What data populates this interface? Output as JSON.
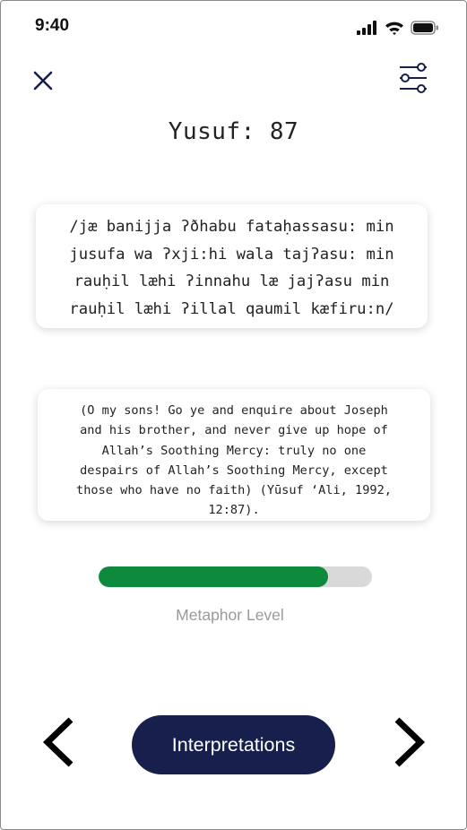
{
  "status_bar": {
    "time": "9:40",
    "icons": [
      "cellular-signal-icon",
      "wifi-icon",
      "battery-icon"
    ]
  },
  "header": {
    "close_icon": "close-icon",
    "filter_icon": "filter-sliders-icon"
  },
  "title": "Yusuf: 87",
  "transcription": "/jæ banijja ʔðhabu fataḥassasu: min\njusufa wa ʔxji:hi wala tajʔasu: min\nrauḥil læhi ʔinnahu læ jajʔasu min\nrauḥil læhi ʔillal qaumil kæfiru:n/",
  "translation": "(O my sons! Go ye and enquire about Joseph\nand his brother, and never give up hope of\nAllah’s Soothing Mercy: truly no one\ndespairs of Allah’s Soothing Mercy, except\nthose who have no faith) (Yūsuf ‘Ali, 1992,\n12:87).",
  "metaphor": {
    "label": "Metaphor Level",
    "level": 0.84
  },
  "footer": {
    "button_label": "Interpretations",
    "prev_icon": "chevron-left-icon",
    "next_icon": "chevron-right-icon"
  },
  "colors": {
    "progress_fill": "#0e8a3c",
    "progress_track": "#d9d9d9",
    "primary_button": "#17204d"
  }
}
